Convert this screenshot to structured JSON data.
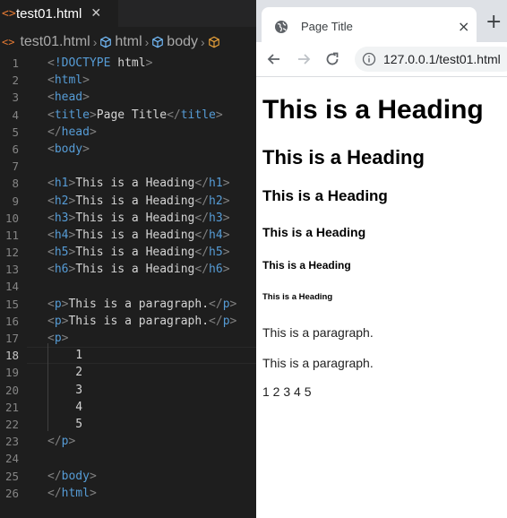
{
  "editor": {
    "tab": {
      "icon": "<>",
      "label": "test01.html",
      "close": "✕"
    },
    "breadcrumb": {
      "file": "test01.html",
      "items": [
        "html",
        "body"
      ]
    },
    "lines": [
      {
        "n": "1",
        "tokens": [
          [
            "br",
            "<"
          ],
          [
            "tag",
            "!DOCTYPE"
          ],
          [
            "br",
            " "
          ],
          [
            "plain",
            "html"
          ],
          [
            "br",
            ">"
          ]
        ]
      },
      {
        "n": "2",
        "tokens": [
          [
            "br",
            "<"
          ],
          [
            "tag",
            "html"
          ],
          [
            "br",
            ">"
          ]
        ]
      },
      {
        "n": "3",
        "tokens": [
          [
            "br",
            "<"
          ],
          [
            "tag",
            "head"
          ],
          [
            "br",
            ">"
          ]
        ]
      },
      {
        "n": "4",
        "tokens": [
          [
            "br",
            "<"
          ],
          [
            "tag",
            "title"
          ],
          [
            "br",
            ">"
          ],
          [
            "plain",
            "Page Title"
          ],
          [
            "br",
            "</"
          ],
          [
            "tag",
            "title"
          ],
          [
            "br",
            ">"
          ]
        ]
      },
      {
        "n": "5",
        "tokens": [
          [
            "br",
            "</"
          ],
          [
            "tag",
            "head"
          ],
          [
            "br",
            ">"
          ]
        ]
      },
      {
        "n": "6",
        "tokens": [
          [
            "br",
            "<"
          ],
          [
            "tag",
            "body"
          ],
          [
            "br",
            ">"
          ]
        ]
      },
      {
        "n": "7",
        "tokens": []
      },
      {
        "n": "8",
        "tokens": [
          [
            "br",
            "<"
          ],
          [
            "tag",
            "h1"
          ],
          [
            "br",
            ">"
          ],
          [
            "plain",
            "This is a Heading"
          ],
          [
            "br",
            "</"
          ],
          [
            "tag",
            "h1"
          ],
          [
            "br",
            ">"
          ]
        ]
      },
      {
        "n": "9",
        "tokens": [
          [
            "br",
            "<"
          ],
          [
            "tag",
            "h2"
          ],
          [
            "br",
            ">"
          ],
          [
            "plain",
            "This is a Heading"
          ],
          [
            "br",
            "</"
          ],
          [
            "tag",
            "h2"
          ],
          [
            "br",
            ">"
          ]
        ]
      },
      {
        "n": "10",
        "tokens": [
          [
            "br",
            "<"
          ],
          [
            "tag",
            "h3"
          ],
          [
            "br",
            ">"
          ],
          [
            "plain",
            "This is a Heading"
          ],
          [
            "br",
            "</"
          ],
          [
            "tag",
            "h3"
          ],
          [
            "br",
            ">"
          ]
        ]
      },
      {
        "n": "11",
        "tokens": [
          [
            "br",
            "<"
          ],
          [
            "tag",
            "h4"
          ],
          [
            "br",
            ">"
          ],
          [
            "plain",
            "This is a Heading"
          ],
          [
            "br",
            "</"
          ],
          [
            "tag",
            "h4"
          ],
          [
            "br",
            ">"
          ]
        ]
      },
      {
        "n": "12",
        "tokens": [
          [
            "br",
            "<"
          ],
          [
            "tag",
            "h5"
          ],
          [
            "br",
            ">"
          ],
          [
            "plain",
            "This is a Heading"
          ],
          [
            "br",
            "</"
          ],
          [
            "tag",
            "h5"
          ],
          [
            "br",
            ">"
          ]
        ]
      },
      {
        "n": "13",
        "tokens": [
          [
            "br",
            "<"
          ],
          [
            "tag",
            "h6"
          ],
          [
            "br",
            ">"
          ],
          [
            "plain",
            "This is a Heading"
          ],
          [
            "br",
            "</"
          ],
          [
            "tag",
            "h6"
          ],
          [
            "br",
            ">"
          ]
        ]
      },
      {
        "n": "14",
        "tokens": []
      },
      {
        "n": "15",
        "tokens": [
          [
            "br",
            "<"
          ],
          [
            "tag",
            "p"
          ],
          [
            "br",
            ">"
          ],
          [
            "plain",
            "This is a paragraph."
          ],
          [
            "br",
            "</"
          ],
          [
            "tag",
            "p"
          ],
          [
            "br",
            ">"
          ]
        ]
      },
      {
        "n": "16",
        "tokens": [
          [
            "br",
            "<"
          ],
          [
            "tag",
            "p"
          ],
          [
            "br",
            ">"
          ],
          [
            "plain",
            "This is a paragraph."
          ],
          [
            "br",
            "</"
          ],
          [
            "tag",
            "p"
          ],
          [
            "br",
            ">"
          ]
        ]
      },
      {
        "n": "17",
        "tokens": [
          [
            "br",
            "<"
          ],
          [
            "tag",
            "p"
          ],
          [
            "br",
            ">"
          ]
        ]
      },
      {
        "n": "18",
        "active": true,
        "tokens": [
          [
            "plain",
            "    1"
          ]
        ]
      },
      {
        "n": "19",
        "tokens": [
          [
            "plain",
            "    2"
          ]
        ]
      },
      {
        "n": "20",
        "tokens": [
          [
            "plain",
            "    3"
          ]
        ]
      },
      {
        "n": "21",
        "tokens": [
          [
            "plain",
            "    4"
          ]
        ]
      },
      {
        "n": "22",
        "tokens": [
          [
            "plain",
            "    5"
          ]
        ]
      },
      {
        "n": "23",
        "tokens": [
          [
            "br",
            "</"
          ],
          [
            "tag",
            "p"
          ],
          [
            "br",
            ">"
          ]
        ]
      },
      {
        "n": "24",
        "tokens": []
      },
      {
        "n": "25",
        "tokens": [
          [
            "br",
            "</"
          ],
          [
            "tag",
            "body"
          ],
          [
            "br",
            ">"
          ]
        ]
      },
      {
        "n": "26",
        "tokens": [
          [
            "br",
            "</"
          ],
          [
            "tag",
            "html"
          ],
          [
            "br",
            ">"
          ]
        ]
      }
    ]
  },
  "browser": {
    "tab_title": "Page Title",
    "tab_close": "×",
    "new_tab": "+",
    "url": "127.0.0.1/test01.html",
    "page": {
      "h1": "This is a Heading",
      "h2": "This is a Heading",
      "h3": "This is a Heading",
      "h4": "This is a Heading",
      "h5": "This is a Heading",
      "h6": "This is a Heading",
      "p1": "This is a paragraph.",
      "p2": "This is a paragraph.",
      "p3": "1 2 3 4 5"
    }
  },
  "colors": {
    "editor_bg": "#1e1e1e",
    "tag": "#569cd6",
    "bracket": "#808080",
    "text": "#d4d4d4",
    "html_file_icon": "#e37933"
  }
}
